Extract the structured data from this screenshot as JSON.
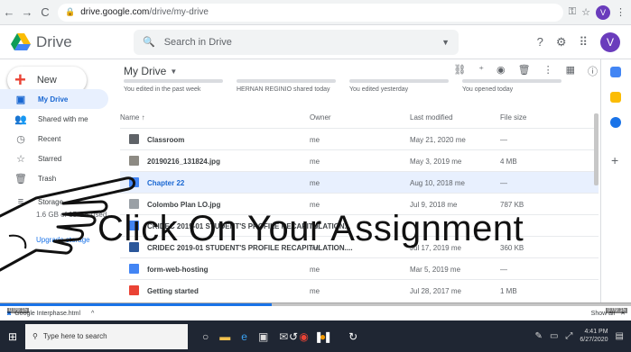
{
  "browser": {
    "url_host": "drive.google.com",
    "url_path": "/drive/my-drive",
    "avatar_letter": "V"
  },
  "header": {
    "app_name": "Drive",
    "search_placeholder": "Search in Drive",
    "avatar_letter": "V"
  },
  "sidebar": {
    "new_label": "New",
    "items": [
      {
        "label": "My Drive",
        "icon": "my-drive-icon",
        "glyph": "▣",
        "active": true
      },
      {
        "label": "Shared with me",
        "icon": "shared-icon",
        "glyph": "👥",
        "active": false
      },
      {
        "label": "Recent",
        "icon": "clock-icon",
        "glyph": "◷",
        "active": false
      },
      {
        "label": "Starred",
        "icon": "star-icon",
        "glyph": "☆",
        "active": false
      },
      {
        "label": "Trash",
        "icon": "trash-icon",
        "glyph": "🗑",
        "active": false
      },
      {
        "label": "Storage",
        "icon": "storage-icon",
        "glyph": "≡",
        "active": false
      }
    ],
    "storage_text": "1.6 GB of 15 GB used",
    "upgrade_label": "Upgrade storage"
  },
  "main": {
    "title": "My Drive",
    "quick_access": [
      {
        "sub": "You edited in the past week"
      },
      {
        "sub": "HERNAN REGINIO shared today"
      },
      {
        "sub": "You edited yesterday"
      },
      {
        "sub": "You opened today"
      }
    ],
    "columns": {
      "name": "Name ↑",
      "owner": "Owner",
      "modified": "Last modified",
      "size": "File size"
    },
    "files": [
      {
        "name": "Classroom",
        "owner": "me",
        "modified": "May 21, 2020 me",
        "size": "—",
        "icon": "folder-icon",
        "color": "#5f6368",
        "selected": false
      },
      {
        "name": "20190216_131824.jpg",
        "owner": "me",
        "modified": "May 3, 2019 me",
        "size": "4 MB",
        "icon": "image-icon",
        "color": "#8d8a83",
        "selected": false
      },
      {
        "name": "Chapter 22",
        "owner": "me",
        "modified": "Aug 10, 2018 me",
        "size": "—",
        "icon": "doc-icon",
        "color": "#4285f4",
        "selected": true
      },
      {
        "name": "Colombo Plan LO.jpg",
        "owner": "me",
        "modified": "Jul 9, 2018 me",
        "size": "787 KB",
        "icon": "image-icon",
        "color": "#9aa0a6",
        "selected": false
      },
      {
        "name": "CRIDEC 2019-01 STUDENT'S PROFILE RECAPITULATION...",
        "owner": "me",
        "modified": "",
        "size": "",
        "icon": "doc-icon",
        "color": "#4285f4",
        "selected": false
      },
      {
        "name": "CRIDEC 2019-01 STUDENT'S PROFILE RECAPITULATION....",
        "owner": "me",
        "modified": "Jul 17, 2019 me",
        "size": "360 KB",
        "icon": "word-icon",
        "color": "#2b579a",
        "selected": false
      },
      {
        "name": "form-web-hosting",
        "owner": "me",
        "modified": "Mar 5, 2019 me",
        "size": "—",
        "icon": "doc-icon",
        "color": "#4285f4",
        "selected": false
      },
      {
        "name": "Getting started",
        "owner": "me",
        "modified": "Jul 28, 2017 me",
        "size": "1 MB",
        "icon": "pdf-icon",
        "color": "#ea4335",
        "selected": false
      }
    ]
  },
  "overlay": {
    "caption": "Click On Your Assignment"
  },
  "video": {
    "time_left": "0:09:15",
    "time_right": "0:09:15",
    "progress": 0.43
  },
  "downloads": {
    "file": "Google Interphase.html",
    "show_all": "Show all"
  },
  "taskbar": {
    "search_placeholder": "Type here to search",
    "time": "4:41 PM",
    "date": "6/27/2020"
  }
}
